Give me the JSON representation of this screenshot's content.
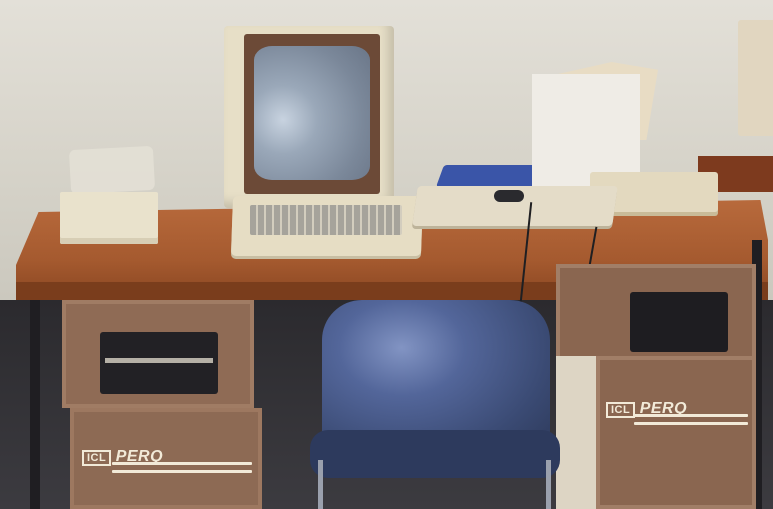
{
  "photo": {
    "description_kind": "photograph",
    "left_tower_brand": {
      "icl": "ICL",
      "perq": "PERQ"
    },
    "right_tower_brand": {
      "icl": "ICL",
      "perq": "PERQ"
    },
    "colors": {
      "desk": "#a55a2f",
      "tower": "#8a6650",
      "chair": "#3a4a73",
      "binder": "#3a55a8",
      "monitor_case": "#e7dfc7"
    }
  }
}
